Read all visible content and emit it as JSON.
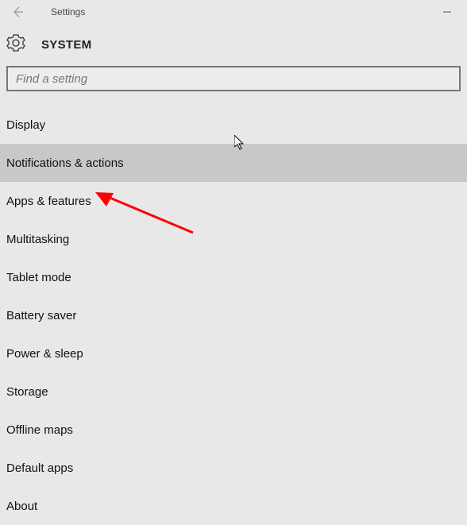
{
  "window": {
    "title": "Settings",
    "minimize_label": "—"
  },
  "page": {
    "heading": "SYSTEM"
  },
  "search": {
    "placeholder": "Find a setting",
    "value": ""
  },
  "menu": {
    "items": [
      {
        "label": "Display",
        "hovered": false
      },
      {
        "label": "Notifications & actions",
        "hovered": true
      },
      {
        "label": "Apps & features",
        "hovered": false
      },
      {
        "label": "Multitasking",
        "hovered": false
      },
      {
        "label": "Tablet mode",
        "hovered": false
      },
      {
        "label": "Battery saver",
        "hovered": false
      },
      {
        "label": "Power & sleep",
        "hovered": false
      },
      {
        "label": "Storage",
        "hovered": false
      },
      {
        "label": "Offline maps",
        "hovered": false
      },
      {
        "label": "Default apps",
        "hovered": false
      },
      {
        "label": "About",
        "hovered": false
      }
    ]
  },
  "annotation": {
    "arrow_color": "#ff0000",
    "arrow_target": "Apps & features"
  }
}
